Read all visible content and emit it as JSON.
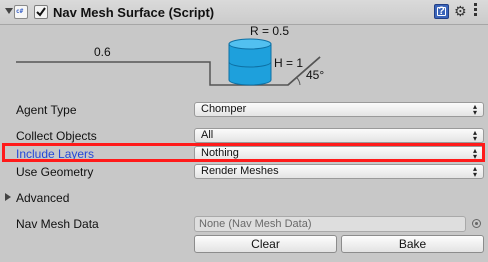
{
  "component": {
    "title": "Nav Mesh Surface (Script)",
    "script_icon_text": "c#",
    "enabled": true,
    "help_icon_text": "?"
  },
  "diagram": {
    "radius_label": "R = 0.5",
    "height_label": "H = 1",
    "step_label": "0.6",
    "slope_label": "45°",
    "agent_color": "#1ea0dc"
  },
  "fields": {
    "agent_type": {
      "label": "Agent Type",
      "value": "Chomper"
    },
    "collect_objects": {
      "label": "Collect Objects",
      "value": "All"
    },
    "include_layers": {
      "label": "Include Layers",
      "value": "Nothing"
    },
    "use_geometry": {
      "label": "Use Geometry",
      "value": "Render Meshes"
    }
  },
  "advanced": {
    "label": "Advanced"
  },
  "nav_mesh_data": {
    "label": "Nav Mesh Data",
    "value": "None (Nav Mesh Data)"
  },
  "buttons": {
    "clear": "Clear",
    "bake": "Bake"
  },
  "colors": {
    "highlight": "#ff1a1a",
    "link_label": "#2549d8"
  }
}
